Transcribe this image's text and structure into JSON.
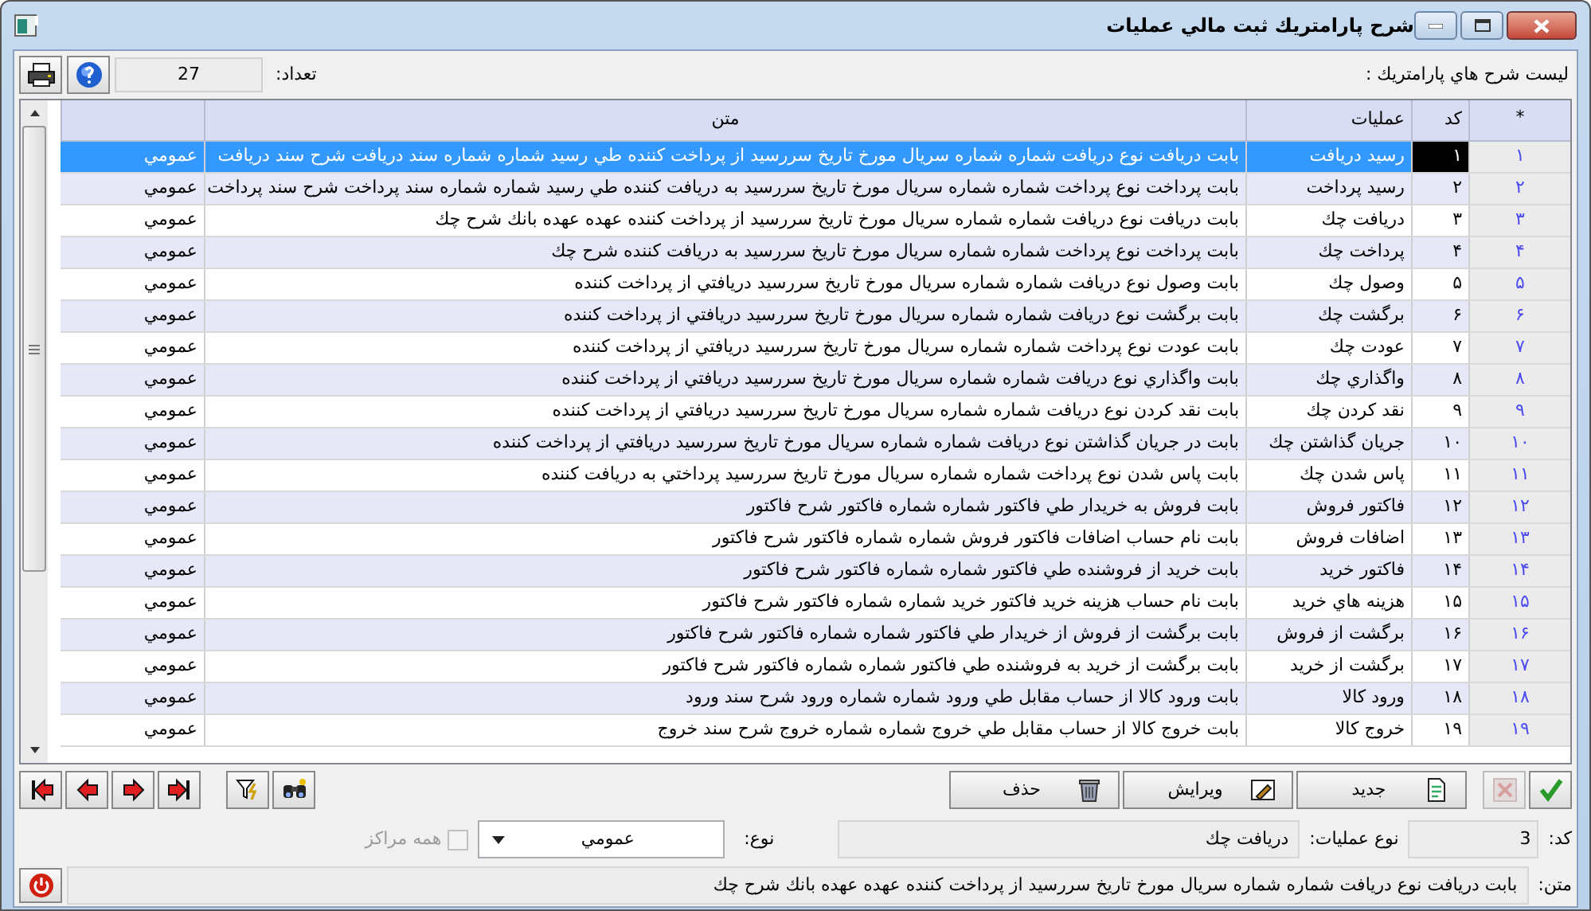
{
  "window": {
    "title": "شرح پارامتريك ثبت مالي عمليات"
  },
  "list_label": "ليست شرح هاي پارامتريك :",
  "count": {
    "label": "تعداد:",
    "value": "27"
  },
  "table": {
    "columns": [
      "*",
      "كد",
      "عمليات",
      "متن"
    ],
    "rows": [
      {
        "row_number": "۱",
        "code": "۱",
        "operation": "رسيد دريافت",
        "text": "بابت دريافت نوع دريافت شماره شماره سريال مورخ تاريخ سررسيد از پرداخت كننده طي رسيد شماره شماره سند دريافت شرح سند دريافت",
        "type": "عمومي",
        "selected": true
      },
      {
        "row_number": "۲",
        "code": "۲",
        "operation": "رسيد پرداخت",
        "text": "بابت پرداخت نوع پرداخت شماره شماره سريال مورخ تاريخ سررسيد به دريافت كننده طي رسيد شماره شماره سند پرداخت شرح سند پرداخت",
        "type": "عمومي",
        "selected": false
      },
      {
        "row_number": "۳",
        "code": "۳",
        "operation": "دريافت چك",
        "text": "بابت دريافت نوع دريافت شماره شماره سريال مورخ تاريخ سررسيد از پرداخت كننده عهده عهده بانك شرح چك",
        "type": "عمومي",
        "selected": false
      },
      {
        "row_number": "۴",
        "code": "۴",
        "operation": "پرداخت چك",
        "text": "بابت پرداخت نوع پرداخت شماره شماره سريال مورخ تاريخ سررسيد به دريافت كننده شرح چك",
        "type": "عمومي",
        "selected": false
      },
      {
        "row_number": "۵",
        "code": "۵",
        "operation": "وصول چك",
        "text": "بابت وصول نوع دريافت شماره شماره سريال مورخ تاريخ سررسيد دريافتي از پرداخت كننده",
        "type": "عمومي",
        "selected": false
      },
      {
        "row_number": "۶",
        "code": "۶",
        "operation": "برگشت چك",
        "text": "بابت برگشت نوع دريافت شماره شماره سريال مورخ تاريخ سررسيد دريافتي از پرداخت كننده",
        "type": "عمومي",
        "selected": false
      },
      {
        "row_number": "۷",
        "code": "۷",
        "operation": "عودت چك",
        "text": "بابت عودت نوع پرداخت شماره شماره سريال مورخ تاريخ سررسيد دريافتي از پرداخت كننده",
        "type": "عمومي",
        "selected": false
      },
      {
        "row_number": "۸",
        "code": "۸",
        "operation": "واگذاري چك",
        "text": "بابت واگذاري نوع دريافت شماره شماره سريال مورخ تاريخ سررسيد دريافتي از پرداخت كننده",
        "type": "عمومي",
        "selected": false
      },
      {
        "row_number": "۹",
        "code": "۹",
        "operation": "نقد كردن چك",
        "text": "بابت نقد كردن نوع دريافت شماره شماره سريال مورخ تاريخ سررسيد دريافتي از پرداخت كننده",
        "type": "عمومي",
        "selected": false
      },
      {
        "row_number": "۱۰",
        "code": "۱۰",
        "operation": "جريان گذاشتن چك",
        "text": "بابت در جريان گذاشتن نوع دريافت شماره شماره سريال مورخ تاريخ سررسيد دريافتي از پرداخت كننده",
        "type": "عمومي",
        "selected": false
      },
      {
        "row_number": "۱۱",
        "code": "۱۱",
        "operation": "پاس شدن چك",
        "text": "بابت پاس شدن نوع پرداخت شماره شماره سريال مورخ تاريخ سررسيد پرداختي به دريافت كننده",
        "type": "عمومي",
        "selected": false
      },
      {
        "row_number": "۱۲",
        "code": "۱۲",
        "operation": "فاكتور فروش",
        "text": "بابت فروش به خريدار طي فاكتور شماره شماره فاكتور شرح فاكتور",
        "type": "عمومي",
        "selected": false
      },
      {
        "row_number": "۱۳",
        "code": "۱۳",
        "operation": "اضافات فروش",
        "text": "بابت نام حساب اضافات فاكتور فروش شماره شماره فاكتور شرح فاكتور",
        "type": "عمومي",
        "selected": false
      },
      {
        "row_number": "۱۴",
        "code": "۱۴",
        "operation": "فاكتور خريد",
        "text": "بابت خريد از فروشنده طي فاكتور شماره شماره فاكتور شرح فاكتور",
        "type": "عمومي",
        "selected": false
      },
      {
        "row_number": "۱۵",
        "code": "۱۵",
        "operation": "هزينه هاي خريد",
        "text": "بابت نام حساب هزينه خريد فاكتور خريد شماره شماره فاكتور شرح فاكتور",
        "type": "عمومي",
        "selected": false
      },
      {
        "row_number": "۱۶",
        "code": "۱۶",
        "operation": "برگشت از فروش",
        "text": "بابت برگشت از فروش از خريدار طي فاكتور شماره شماره فاكتور شرح فاكتور",
        "type": "عمومي",
        "selected": false
      },
      {
        "row_number": "۱۷",
        "code": "۱۷",
        "operation": "برگشت از خريد",
        "text": "بابت برگشت از خريد به فروشنده طي فاكتور شماره شماره فاكتور شرح فاكتور",
        "type": "عمومي",
        "selected": false
      },
      {
        "row_number": "۱۸",
        "code": "۱۸",
        "operation": "ورود كالا",
        "text": "بابت ورود كالا از حساب مقابل طي ورود شماره شماره ورود شرح سند ورود",
        "type": "عمومي",
        "selected": false
      },
      {
        "row_number": "۱۹",
        "code": "۱۹",
        "operation": "خروج كالا",
        "text": "بابت خروج كالا از حساب مقابل طي خروج شماره شماره خروج شرح سند خروج",
        "type": "عمومي",
        "selected": false
      }
    ]
  },
  "nav_buttons": [
    {
      "kind": "first"
    },
    {
      "kind": "previous"
    },
    {
      "kind": "next"
    },
    {
      "kind": "last"
    },
    {
      "kind": "filter"
    },
    {
      "kind": "find"
    }
  ],
  "action_buttons": [
    {
      "kind": "confirm",
      "disabled": false
    },
    {
      "kind": "cancel",
      "disabled": true
    },
    {
      "kind": "new",
      "label": "جديد",
      "disabled": false
    },
    {
      "kind": "edit",
      "label": "ويرايش",
      "disabled": false
    },
    {
      "kind": "delete",
      "label": "حذف",
      "disabled": false
    }
  ],
  "form": {
    "code": {
      "label": "كد:",
      "value": "3"
    },
    "operation": {
      "label": "نوع عمليات:",
      "value": "دريافت چك"
    },
    "type": {
      "label": "نوع:",
      "value": "عمومي"
    },
    "all_centers": {
      "label": "همه مراكز",
      "checked": false,
      "disabled": true
    },
    "text": {
      "label": "متن:",
      "value": "بابت دريافت نوع دريافت شماره شماره سريال مورخ تاريخ سررسيد از پرداخت كننده عهده عهده بانك شرح چك"
    }
  }
}
